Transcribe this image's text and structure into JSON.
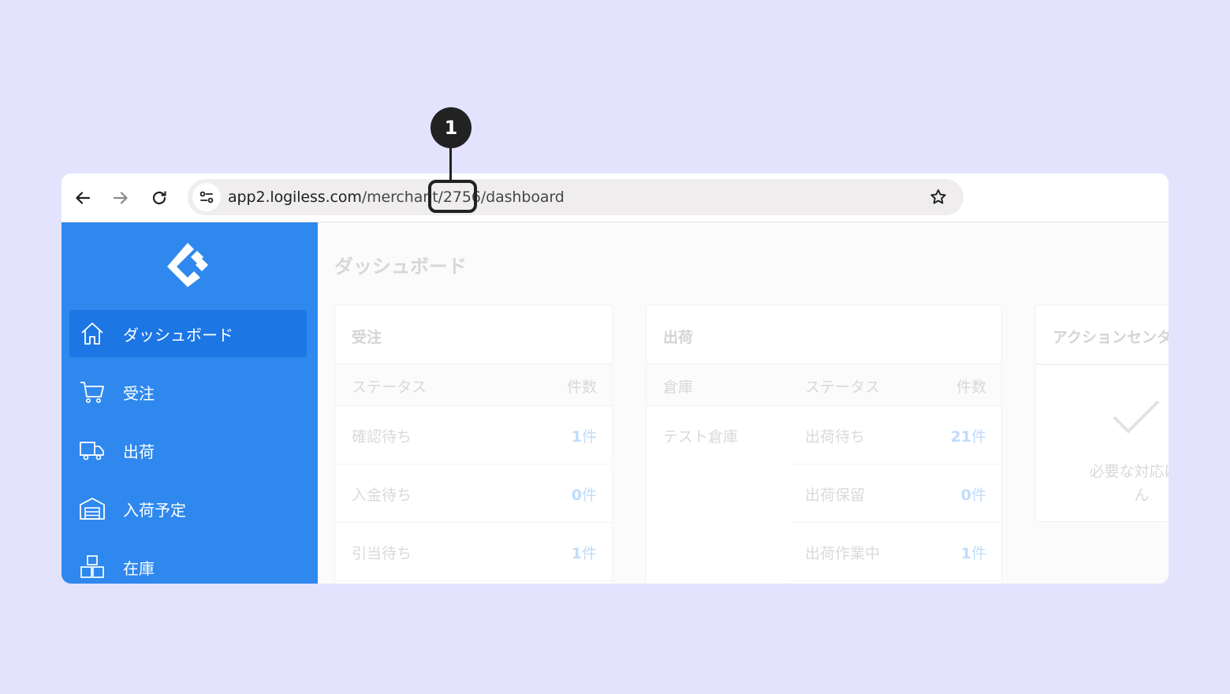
{
  "browser": {
    "url_host": "app2.logiless.com",
    "url_path_before": "/merchant/",
    "url_highlight": "2756",
    "url_path_after": "/dashboard"
  },
  "annotation": {
    "number": "1"
  },
  "sidebar": {
    "items": [
      {
        "label": "ダッシュボード",
        "icon": "home-icon"
      },
      {
        "label": "受注",
        "icon": "cart-icon"
      },
      {
        "label": "出荷",
        "icon": "truck-icon"
      },
      {
        "label": "入荷予定",
        "icon": "warehouse-icon"
      },
      {
        "label": "在庫",
        "icon": "boxes-icon"
      }
    ]
  },
  "main": {
    "title": "ダッシュボード",
    "orders": {
      "title": "受注",
      "headers": [
        "ステータス",
        "件数"
      ],
      "rows": [
        {
          "status": "確認待ち",
          "count": "1",
          "unit": "件"
        },
        {
          "status": "入金待ち",
          "count": "0",
          "unit": "件"
        },
        {
          "status": "引当待ち",
          "count": "1",
          "unit": "件"
        }
      ]
    },
    "shipping": {
      "title": "出荷",
      "headers": [
        "倉庫",
        "ステータス",
        "件数"
      ],
      "warehouse": "テスト倉庫",
      "rows": [
        {
          "status": "出荷待ち",
          "count": "21",
          "unit": "件"
        },
        {
          "status": "出荷保留",
          "count": "0",
          "unit": "件"
        },
        {
          "status": "出荷作業中",
          "count": "1",
          "unit": "件"
        }
      ]
    },
    "action_center": {
      "title": "アクションセンタ",
      "empty_line1": "必要な対応はあ",
      "empty_line2": "ん"
    }
  },
  "colors": {
    "background": "#e4e3fe",
    "sidebar": "#2f88ee",
    "sidebar_active": "#1c76e4",
    "count_text": "#bfdcfb",
    "annotation": "#222222"
  }
}
